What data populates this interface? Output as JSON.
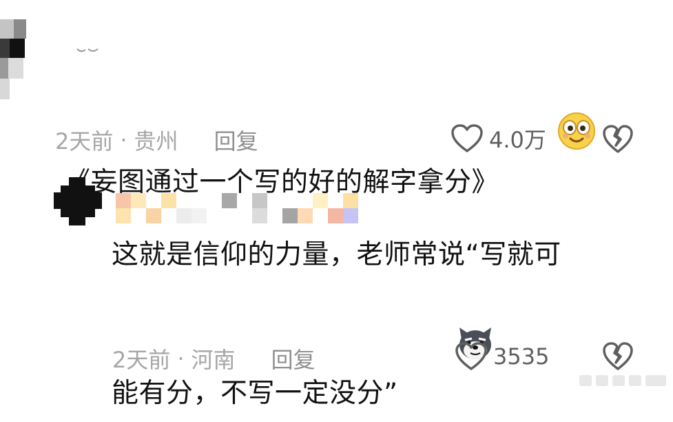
{
  "comments": [
    {
      "text": "《妄图通过一个写的好的解字拿分》",
      "emoji_name": "smiling-face-emoji",
      "time": "2天前",
      "location": "贵州",
      "separator": "·",
      "reply_label": "回复",
      "likes": "4.0万"
    },
    {
      "text": "这就是信仰的力量，老师常说“写就可\n能有分，不写一定没分”",
      "emoji_name": "dog-face-emoji",
      "time": "2天前",
      "location": "河南",
      "separator": "·",
      "reply_label": "回复",
      "likes": "3535"
    }
  ],
  "icons": {
    "like": "heart-outline-icon",
    "dislike": "broken-heart-icon"
  },
  "colors": {
    "meta_gray": "#a6a6a6",
    "icon_gray": "#5f5f5f",
    "emoji_yellow": "#f7d34a"
  }
}
